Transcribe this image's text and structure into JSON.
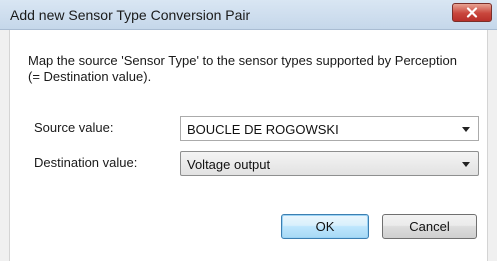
{
  "dialog": {
    "title": "Add new Sensor Type Conversion Pair",
    "instructions": "Map the source 'Sensor Type' to the sensor types supported by Perception  (= Destination value).",
    "source": {
      "label": "Source value:",
      "value": "BOUCLE DE ROGOWSKI"
    },
    "destination": {
      "label": "Destination value:",
      "value": "Voltage output"
    },
    "buttons": {
      "ok": "OK",
      "cancel": "Cancel"
    }
  },
  "colors": {
    "titlebar": "#c5d7ea",
    "close_button": "#c9463c",
    "default_button_border": "#3c7fb1",
    "background": "#ffffff"
  },
  "icons": {
    "close": "close-icon",
    "dropdown": "chevron-down-icon"
  }
}
